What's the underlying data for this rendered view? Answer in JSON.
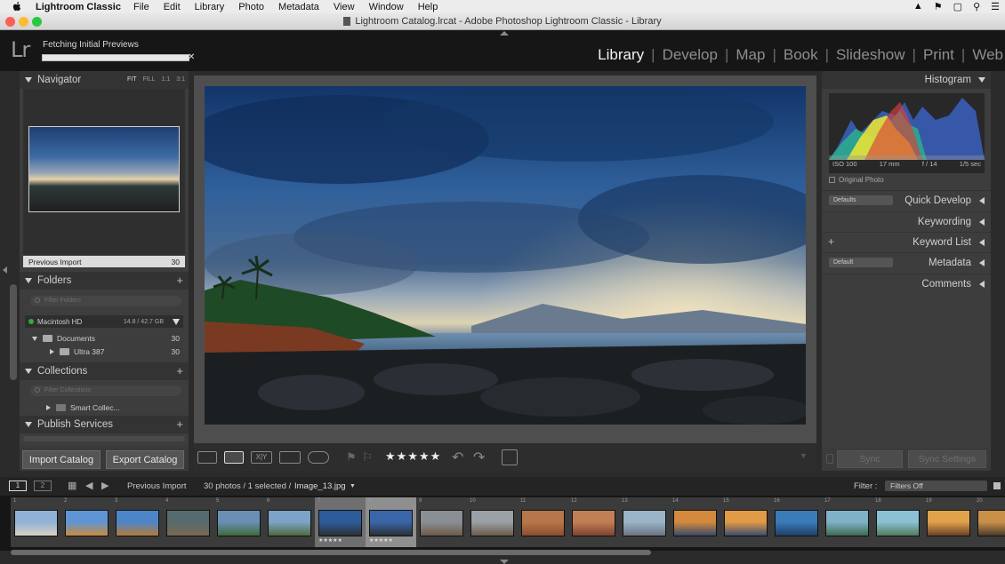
{
  "menubar": {
    "app_name": "Lightroom Classic",
    "items": [
      "File",
      "Edit",
      "Library",
      "Photo",
      "Metadata",
      "View",
      "Window",
      "Help"
    ]
  },
  "window": {
    "title": "Lightroom Catalog.lrcat - Adobe Photoshop Lightroom Classic - Library"
  },
  "identity": {
    "logo": "Lr",
    "status_text": "Fetching Initial Previews",
    "progress": 1.0
  },
  "modules": {
    "items": [
      "Library",
      "Develop",
      "Map",
      "Book",
      "Slideshow",
      "Print",
      "Web"
    ],
    "active": "Library"
  },
  "left_panel": {
    "navigator": {
      "title": "Navigator",
      "zoom_options": [
        "FIT",
        "FILL",
        "1:1",
        "3:1"
      ]
    },
    "previous_import": {
      "label": "Previous Import",
      "count": "30"
    },
    "folders": {
      "title": "Folders",
      "filter_placeholder": "Filter Folders",
      "volume": {
        "name": "Macintosh HD",
        "capacity": "14.8 / 42.7 GB"
      },
      "items": [
        {
          "label": "Documents",
          "count": "30"
        },
        {
          "label": "Ultra 387",
          "count": "30"
        }
      ]
    },
    "collections": {
      "title": "Collections",
      "filter_placeholder": "Filter Collections",
      "items": [
        {
          "label": "Smart Collec..."
        }
      ]
    },
    "publish_services": {
      "title": "Publish Services"
    },
    "buttons": {
      "import": "Import Catalog",
      "export": "Export Catalog"
    }
  },
  "toolbar": {
    "rating": "★★★★★"
  },
  "right_panel": {
    "histogram": {
      "title": "Histogram",
      "iso": "ISO 100",
      "focal": "17 mm",
      "aperture": "f / 14",
      "shutter": "1/5 sec",
      "original_photo": "Original Photo"
    },
    "sections": [
      {
        "label": "Quick Develop",
        "dropdown": "Defaults"
      },
      {
        "label": "Keywording"
      },
      {
        "label": "Keyword List",
        "plus": "+"
      },
      {
        "label": "Metadata",
        "dropdown": "Default"
      },
      {
        "label": "Comments"
      }
    ],
    "buttons": {
      "sync": "Sync",
      "sync_settings": "Sync Settings"
    }
  },
  "filmstrip_bar": {
    "view1": "1",
    "view2": "2",
    "source": "Previous Import",
    "info": "30 photos / 1 selected /",
    "filename": "Image_13.jpg",
    "filter_label": "Filter :",
    "filter_value": "Filters Off"
  },
  "filmstrip": {
    "cells": [
      {
        "num": "1"
      },
      {
        "num": "2"
      },
      {
        "num": "3"
      },
      {
        "num": "4"
      },
      {
        "num": "5"
      },
      {
        "num": "6"
      },
      {
        "num": "7",
        "rating": "★★★★★"
      },
      {
        "num": "8",
        "rating": "★★★★★"
      },
      {
        "num": "9"
      },
      {
        "num": "10"
      },
      {
        "num": "11"
      },
      {
        "num": "12"
      },
      {
        "num": "13"
      },
      {
        "num": "14"
      },
      {
        "num": "15"
      },
      {
        "num": "16"
      },
      {
        "num": "17"
      },
      {
        "num": "18"
      },
      {
        "num": "19"
      },
      {
        "num": "20"
      }
    ]
  },
  "colors": {
    "active_module": "#f2f2f2",
    "panel_bg": "#3d3d3d",
    "chrome_bg": "#161616"
  }
}
